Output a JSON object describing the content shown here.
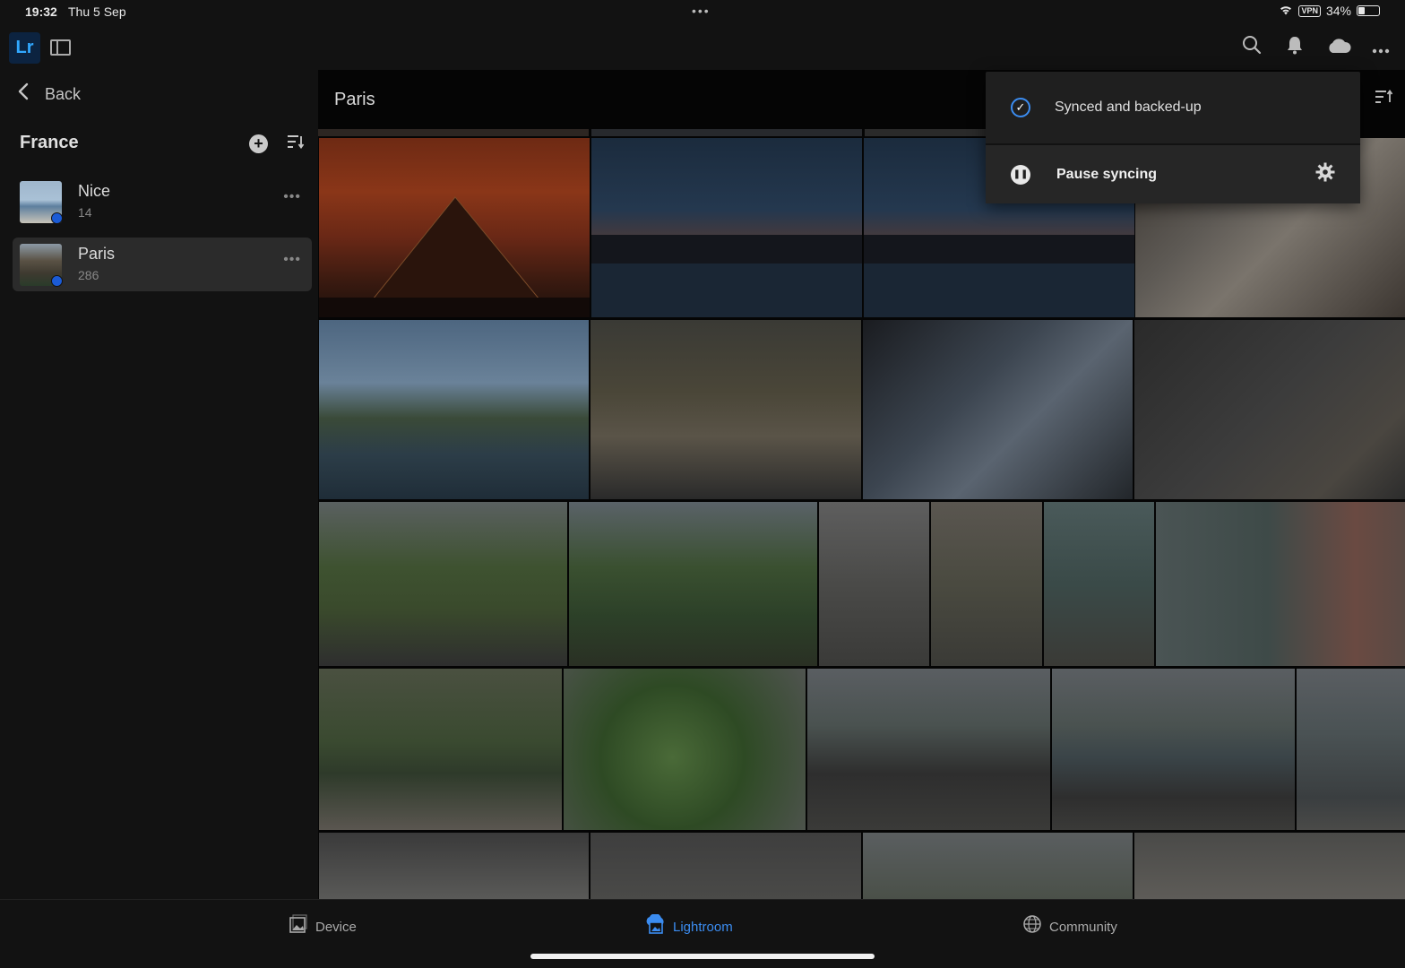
{
  "status_bar": {
    "time": "19:32",
    "date": "Thu 5 Sep",
    "dots": "•••",
    "vpn": "VPN",
    "battery": "34%"
  },
  "app_bar": {
    "logo": "Lr",
    "icons": [
      "search-icon",
      "bell-icon",
      "cloud-icon",
      "more-icon"
    ]
  },
  "sidebar": {
    "back_label": "Back",
    "folder_title": "France",
    "albums": [
      {
        "name": "Nice",
        "count": "14"
      },
      {
        "name": "Paris",
        "count": "286"
      }
    ]
  },
  "main": {
    "title": "Paris"
  },
  "popover": {
    "synced_label": "Synced and backed-up",
    "pause_label": "Pause syncing"
  },
  "tab_bar": {
    "tabs": [
      {
        "label": "Device"
      },
      {
        "label": "Lightroom"
      },
      {
        "label": "Community"
      }
    ]
  },
  "colors": {
    "accent": "#3b8cf0",
    "background": "#121212",
    "panel": "#1f1f1f"
  }
}
